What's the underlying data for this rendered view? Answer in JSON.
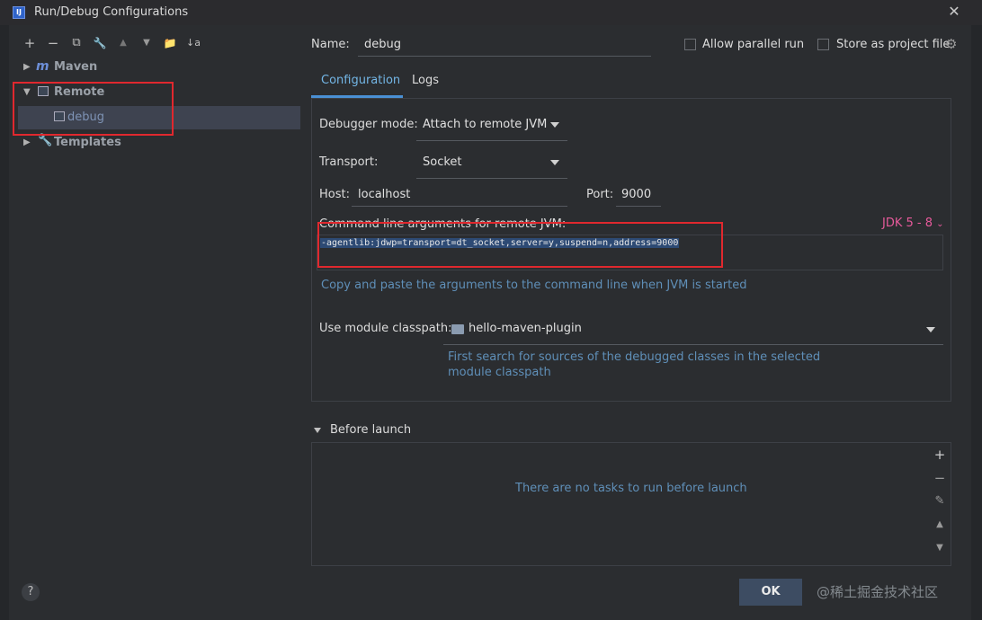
{
  "window": {
    "title": "Run/Debug Configurations",
    "app_icon": "IJ"
  },
  "toolbar": {
    "add": "+",
    "remove": "−",
    "copy": "⧉",
    "edit": "🔧",
    "up": "▲",
    "down": "▼",
    "folder": "📁",
    "sort": "↓a"
  },
  "tree": {
    "maven": {
      "icon": "m",
      "label": "Maven"
    },
    "remote": {
      "label": "Remote"
    },
    "debug": {
      "label": "debug"
    },
    "templates": {
      "label": "Templates"
    }
  },
  "config": {
    "name_label": "Name:",
    "name_value": "debug",
    "allow_parallel": "Allow parallel run",
    "store_project": "Store as project file",
    "tabs": [
      "Configuration",
      "Logs"
    ],
    "debugger_mode_label": "Debugger mode:",
    "debugger_mode_value": "Attach to remote JVM",
    "transport_label": "Transport:",
    "transport_value": "Socket",
    "host_label": "Host:",
    "host_value": "localhost",
    "port_label": "Port:",
    "port_value": "9000",
    "cmd_label": "Command line arguments for remote JVM:",
    "jdk_label": "JDK 5 - 8",
    "cmd_value": "-agentlib:jdwp=transport=dt_socket,server=y,suspend=n,address=9000",
    "cmd_hint": "Copy and paste the arguments to the command line when JVM is started",
    "module_label": "Use module classpath:",
    "module_value": "hello-maven-plugin",
    "module_hint_1": "First search for sources of the debugged classes in the selected",
    "module_hint_2": "module classpath"
  },
  "before_launch": {
    "label": "Before launch",
    "empty_text": "There are no tasks to run before launch",
    "side_buttons": {
      "add": "+",
      "remove": "−",
      "edit": "✎",
      "up": "▲",
      "down": "▼"
    }
  },
  "footer": {
    "help": "?",
    "ok": "OK",
    "watermark": "@稀土掘金技术社区"
  },
  "colors": {
    "accent": "#4a90d4",
    "highlight_box": "#e0282e",
    "jdk": "#e75a9b"
  }
}
